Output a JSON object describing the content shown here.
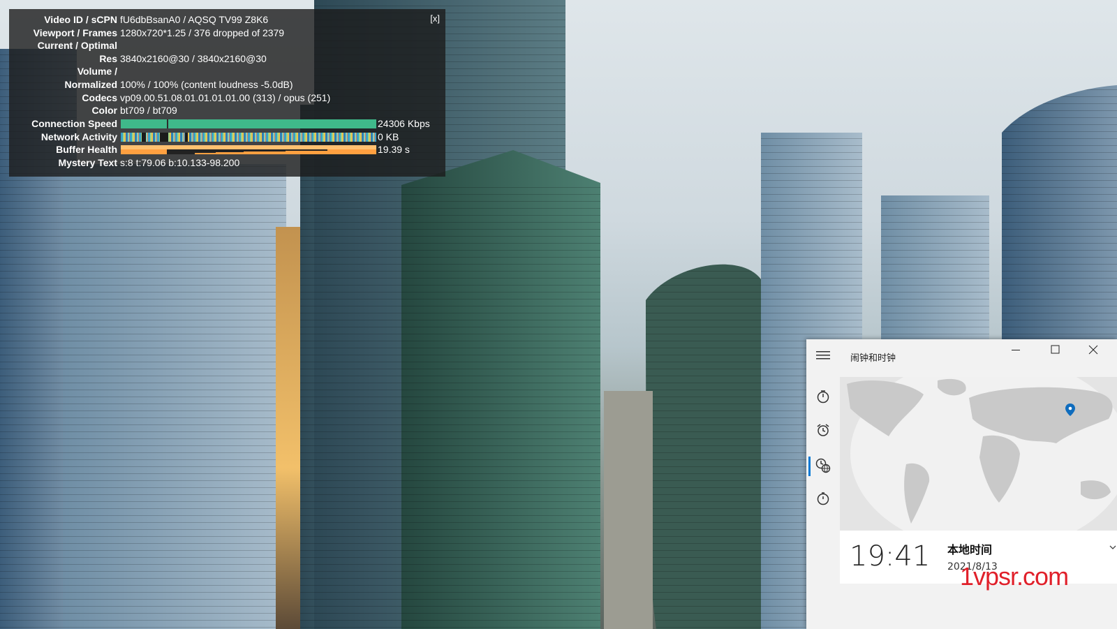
{
  "stats": {
    "close_label": "[x]",
    "rows": [
      {
        "label": "Video ID / sCPN",
        "value": "fU6dbBsanA0 / AQSQ TV99 Z8K6"
      },
      {
        "label": "Viewport / Frames",
        "value": "1280x720*1.25 / 376 dropped of 2379"
      },
      {
        "label": "Current / Optimal",
        "value": ""
      },
      {
        "label": "Res",
        "value": "3840x2160@30 / 3840x2160@30"
      },
      {
        "label": "Volume /",
        "value": ""
      },
      {
        "label": "Normalized",
        "value": "100% / 100% (content loudness -5.0dB)"
      },
      {
        "label": "Codecs",
        "value": "vp09.00.51.08.01.01.01.01.00 (313) / opus (251)"
      },
      {
        "label": "Color",
        "value": "bt709 / bt709"
      }
    ],
    "connection_speed": {
      "label": "Connection Speed",
      "value": "24306 Kbps"
    },
    "network_activity": {
      "label": "Network Activity",
      "value": "0 KB"
    },
    "buffer_health": {
      "label": "Buffer Health",
      "value": "19.39 s"
    },
    "mystery_text": {
      "label": "Mystery Text",
      "value": "s:8 t:79.06 b:10.133-98.200"
    }
  },
  "clock_app": {
    "title": "闹钟和时钟",
    "nav_icons": [
      "hamburger-icon",
      "timer-icon",
      "alarm-icon",
      "world-clock-icon",
      "stopwatch-icon"
    ],
    "selected_nav": "world-clock-icon",
    "accent_color": "#0078d4",
    "local_time": "19:41",
    "local_label": "本地时间",
    "local_date": "2021/8/13"
  },
  "watermark": "1vpsr.com"
}
